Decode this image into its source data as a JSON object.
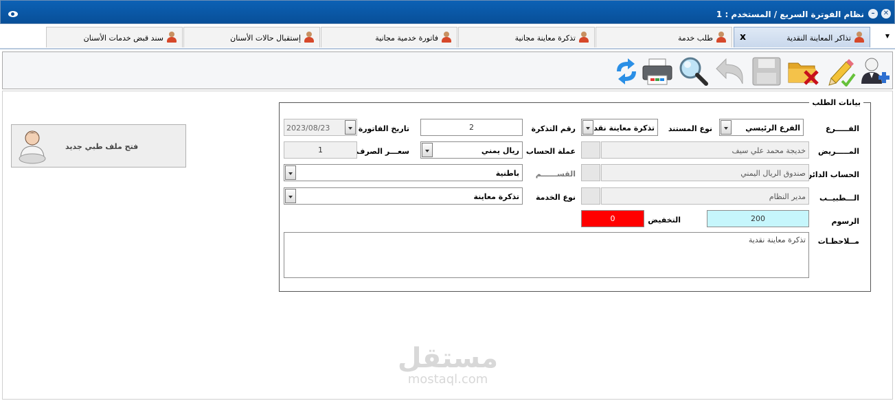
{
  "window": {
    "title": "نظام الفوترة السريع / المستخدم : 1"
  },
  "tabs": [
    {
      "label": "تذاكر المعاينة النقدية",
      "active": true
    },
    {
      "label": "طلب خدمة"
    },
    {
      "label": "تذكرة معاينة مجانية"
    },
    {
      "label": "فاتورة خدمية مجانية"
    },
    {
      "label": "إستقبال حالات الأسنان"
    },
    {
      "label": "سند قبض خدمات الأسنان"
    }
  ],
  "toolbar": {
    "buttons": [
      "add-user",
      "edit",
      "delete",
      "save",
      "undo",
      "search",
      "print",
      "refresh"
    ]
  },
  "form": {
    "legend": "بيانات الطلب",
    "branch_label": "الفـــــرع",
    "branch_value": "الفرع الرئيسي",
    "doc_type_label": "نوع المستند",
    "doc_type_value": "تذكرة معاينة نقد",
    "ticket_no_label": "رقم التذكرة",
    "ticket_no_value": "2",
    "invoice_date_label": "تاريخ الفاتورة",
    "invoice_date_value": "2023/08/23",
    "patient_label": "المـــــريض",
    "patient_value": "خديجة محمد علي سيف",
    "account_currency_label": "عملة الحساب",
    "account_currency_value": "ريال يمني",
    "exchange_rate_label": "سعـــر الصرف",
    "exchange_rate_value": "1",
    "creditor_label": "الحساب الدائن",
    "creditor_value": "صندوق الريال اليمني",
    "department_label": "القســــــم",
    "department_value": "باطنية",
    "doctor_label": "الـــطبيــب",
    "doctor_value": "مدير النظام",
    "service_type_label": "نوع الخدمة",
    "service_type_value": "تذكرة معاينة",
    "fees_label": "الرسوم",
    "fees_value": "200",
    "discount_label": "التخفيض",
    "discount_value": "0",
    "notes_label": "مــلاحظـات",
    "notes_value": "تذكرة معاينة نقدية"
  },
  "new_file_button": {
    "label": "فتح ملف طبي جديد"
  },
  "watermark": {
    "arabic": "مستقل",
    "latin": "mostaql.com"
  },
  "colors": {
    "titlebar": "#0c61b5",
    "fees_bg": "#c6f6fc",
    "discount_bg": "#ff0000"
  }
}
